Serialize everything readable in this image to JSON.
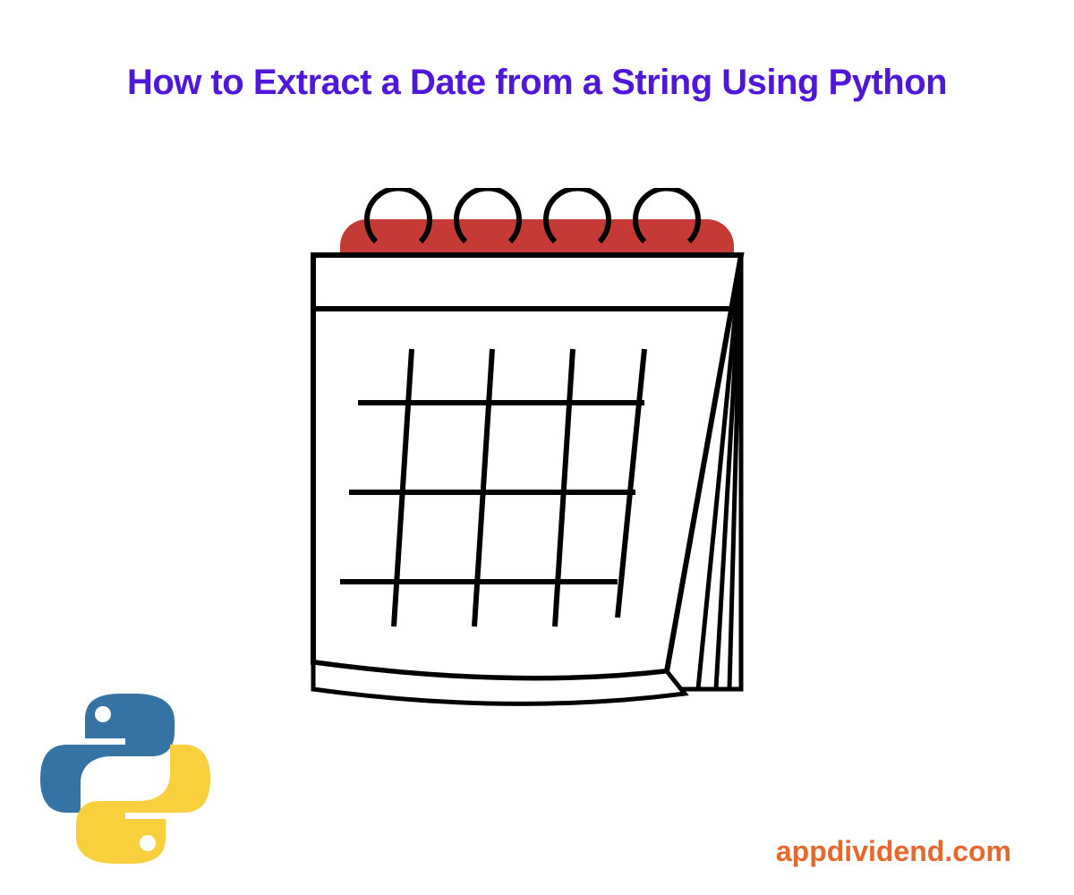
{
  "title": "How to Extract a Date from a String Using Python",
  "site_name": "appdividend.com",
  "colors": {
    "title": "#5016d9",
    "site": "#e7682c",
    "calendar_header": "#c63a36",
    "python_blue": "#3573a5",
    "python_yellow": "#f8cf3d"
  },
  "icons": {
    "calendar": "calendar-icon",
    "python": "python-logo-icon"
  }
}
